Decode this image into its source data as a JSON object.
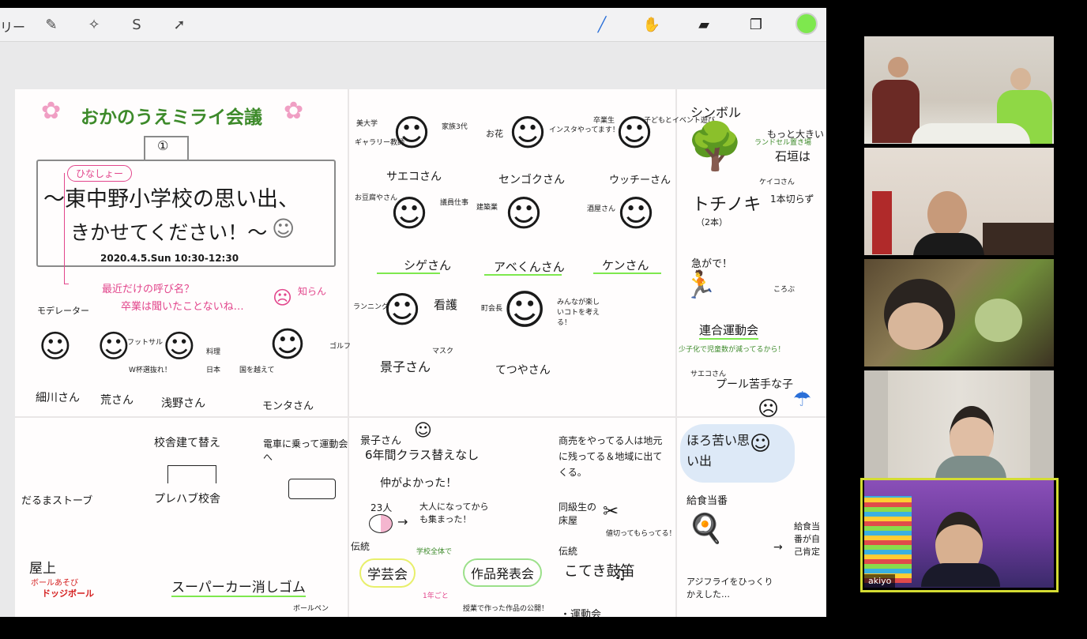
{
  "toolbar": {
    "gallery_label": "リー",
    "color": "#7ee84e"
  },
  "title": "おかのうえミライ会議",
  "session_no": "①",
  "sign_label": "ひなしょー",
  "theme_line1": "〜東中野小学校の思い出、",
  "theme_line2": "きかせてください！〜",
  "date": "2020.4.5.Sun 10:30-12:30",
  "pink_note1": "最近だけの呼び名？",
  "pink_note2": "卒業は聞いたことないね…",
  "pink_note3": "知らん",
  "moderator_label": "モデレーター",
  "moderators": [
    "細川さん",
    "荒さん",
    "浅野さん",
    "モンタさん"
  ],
  "mod_notes": [
    "フットサル",
    "W杯選抜れ！",
    "料理",
    "日本",
    "ゴルフ",
    "国を越えて"
  ],
  "participants": [
    "サエコさん",
    "センゴクさん",
    "ウッチーさん",
    "シゲさん",
    "アベくんさん",
    "ケンさん",
    "景子さん",
    "てつやさん"
  ],
  "participant_notes": [
    "美大学",
    "ギャラリー教師",
    "家族3代",
    "お花",
    "インスタやってます！",
    "卒業生",
    "子どもとイベント遊び",
    "お豆腐やさん",
    "議員仕事",
    "建築業",
    "酒屋さん",
    "ランニング",
    "看護",
    "マスク",
    "町会長",
    "みんなが楽しいコトを考える！"
  ],
  "symbol_section": {
    "title": "シンボル",
    "tree": "トチノキ",
    "count": "（2本）",
    "notes": [
      "もっと大きい",
      "石垣は",
      "1本切らず"
    ],
    "small_notes": [
      "ランドセル置き場",
      "ケイコさん"
    ]
  },
  "undokai": {
    "note1": "急がで！",
    "note2": "ころぶ",
    "title": "連合運動会",
    "note3": "少子化で児童数が減ってるから！"
  },
  "pool": {
    "name": "サエコさん",
    "text": "プール苦手な子"
  },
  "lower": {
    "building": "校舎建て替え",
    "prefab": "プレハブ校舎",
    "car_ride": "電車に乗って運動会へ",
    "stove": "だるまストーブ",
    "roof": "屋上",
    "roof_note": "ボールあそび",
    "dodge": "ドッジボール",
    "eraser": "スーパーカー消しゴム"
  },
  "middle": {
    "name": "景子さん",
    "six": "6年間クラス替えなし",
    "same": "仲がよかった！",
    "num": "23人",
    "gather": "大人になってからも集まった！",
    "tradition": "伝統",
    "event1": "学芸会",
    "event2": "作品発表会",
    "every": "1年ごと",
    "whole": "学校全体で",
    "extra1": "ボールペン",
    "extra2": "授業で作った作品の公開！"
  },
  "right_lower": {
    "shop": "商売をやってる人は地元に残ってる＆地域に出てくる。",
    "classmate": "同級生の床屋",
    "cheap": "値切ってもらってる！",
    "tradition": "伝統",
    "drum": "こてき鼓笛",
    "undo": "・運動会"
  },
  "bitter": {
    "title": "ほろ苦い思い出",
    "item": "給食当番",
    "fry": "アジフライをひっくりかえした…",
    "note": "給食当番が自己肯定"
  },
  "participants_video": {
    "name_tag": "akiyo"
  }
}
